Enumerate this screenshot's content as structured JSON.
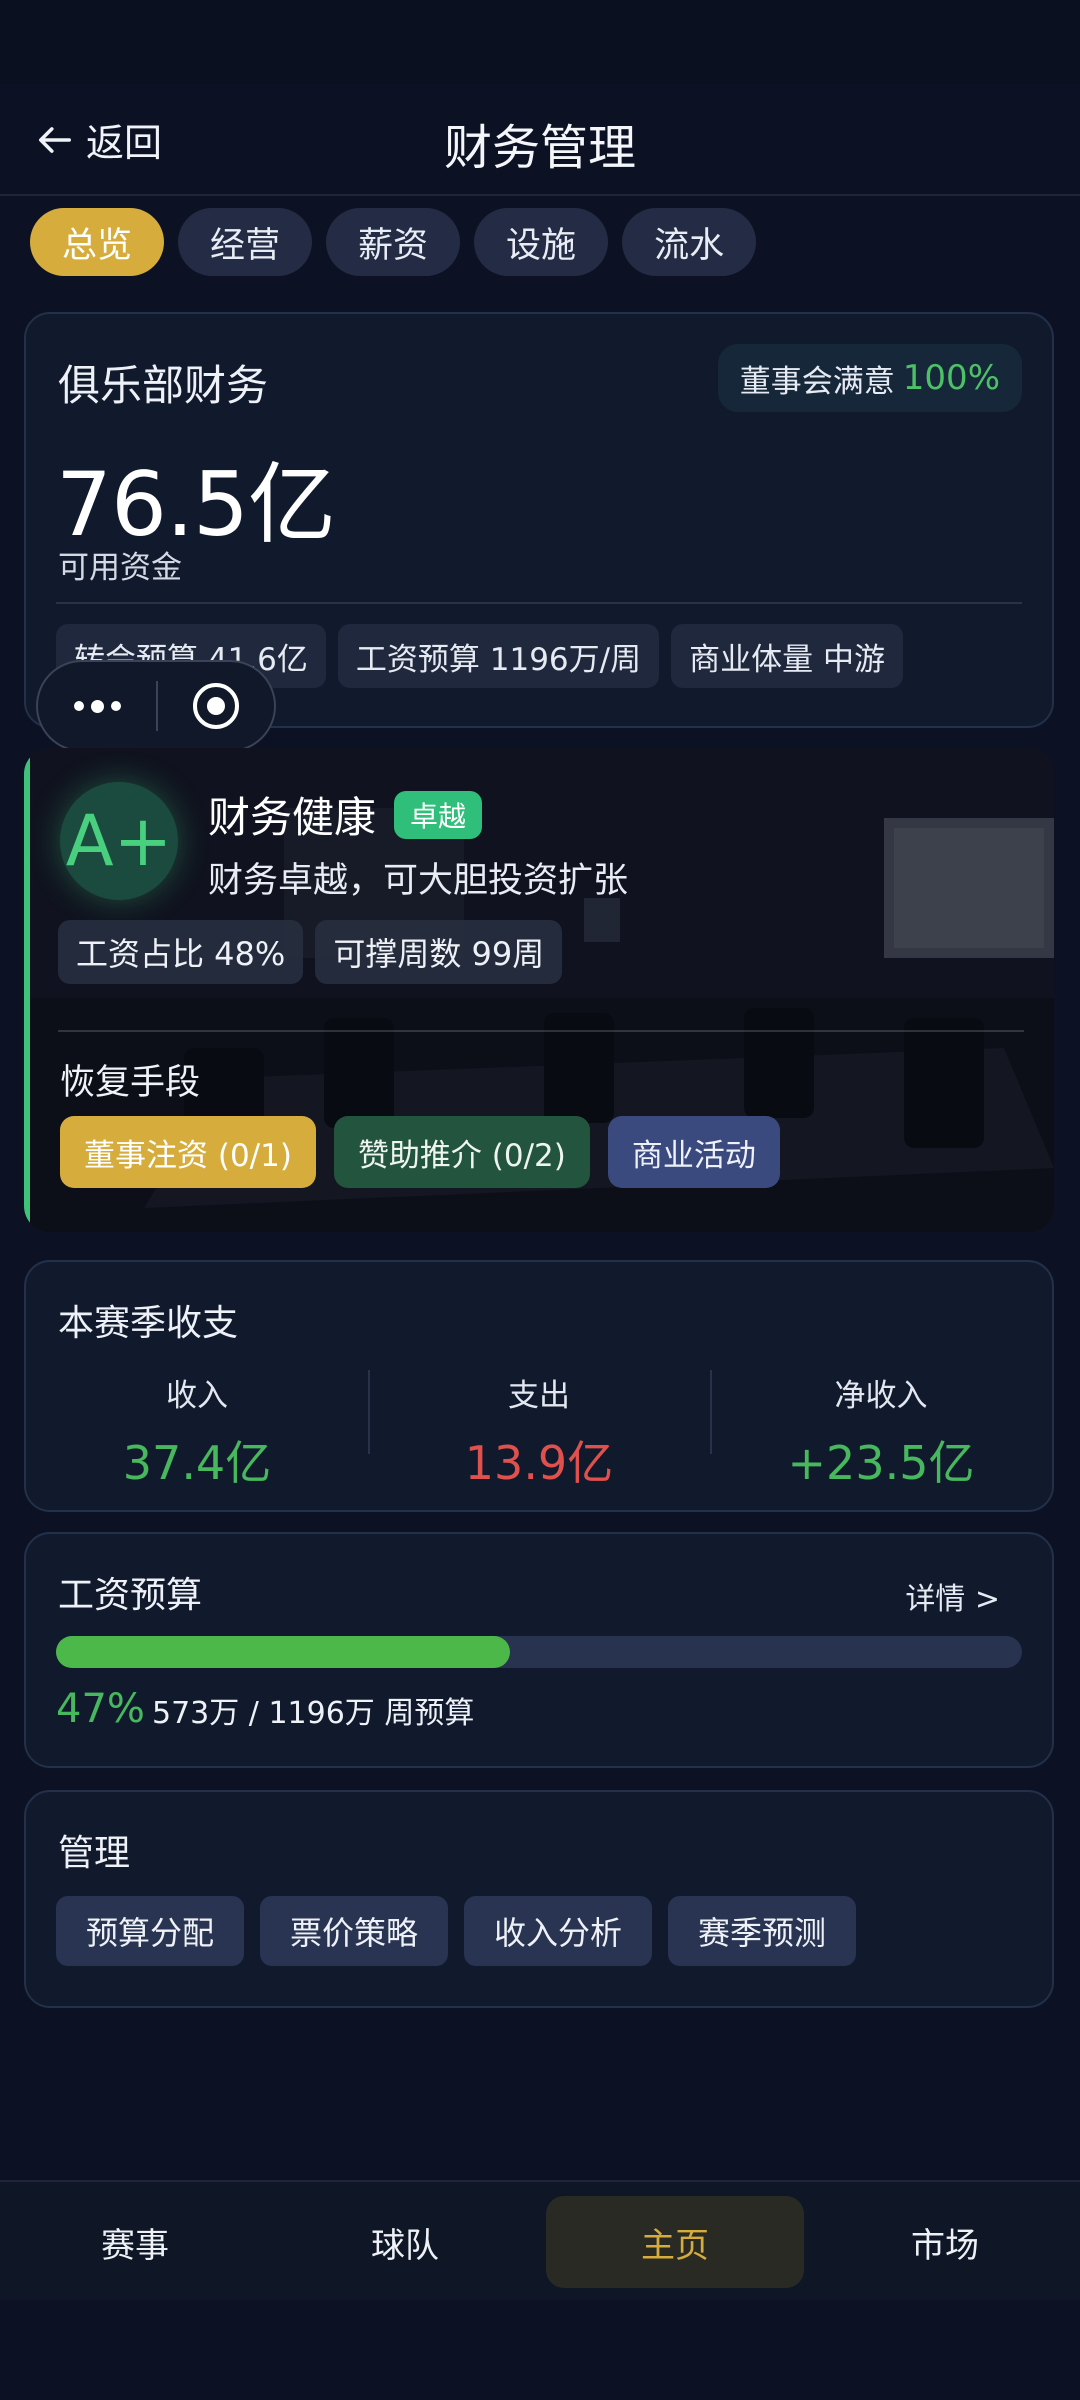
{
  "header": {
    "back_label": "返回",
    "title": "财务管理"
  },
  "tabs": [
    {
      "label": "总览",
      "active": true
    },
    {
      "label": "经营",
      "active": false
    },
    {
      "label": "薪资",
      "active": false
    },
    {
      "label": "设施",
      "active": false
    },
    {
      "label": "流水",
      "active": false
    }
  ],
  "club_finance": {
    "title": "俱乐部财务",
    "board_label": "董事会满意",
    "board_value": "100%",
    "funds": "76.5亿",
    "funds_label": "可用资金",
    "chips": [
      "转会预算 41.6亿",
      "工资预算 1196万/周",
      "商业体量 中游"
    ]
  },
  "health": {
    "grade": "A+",
    "title": "财务健康",
    "badge": "卓越",
    "subtitle": "财务卓越，可大胆投资扩张",
    "chips": [
      "工资占比 48%",
      "可撑周数 99周"
    ],
    "recovery_title": "恢复手段",
    "recovery_buttons": [
      "董事注资 (0/1)",
      "赞助推介 (0/2)",
      "商业活动"
    ]
  },
  "season": {
    "title": "本赛季收支",
    "income_label": "收入",
    "income_value": "37.4亿",
    "expense_label": "支出",
    "expense_value": "13.9亿",
    "net_label": "净收入",
    "net_value": "+23.5亿"
  },
  "salary": {
    "title": "工资预算",
    "details": "详情 >",
    "percent_text": "47%",
    "progress": 0.47,
    "amount_text": "573万 / 1196万 周预算"
  },
  "manage": {
    "title": "管理",
    "buttons": [
      "预算分配",
      "票价策略",
      "收入分析",
      "赛季预测"
    ]
  },
  "bottom_nav": [
    {
      "label": "赛事",
      "active": false
    },
    {
      "label": "球队",
      "active": false
    },
    {
      "label": "主页",
      "active": true
    },
    {
      "label": "市场",
      "active": false
    }
  ],
  "colors": {
    "accent_gold": "#d6ad3c",
    "positive_green": "#47b85e",
    "negative_red": "#e0504d",
    "background": "#0c1223"
  }
}
